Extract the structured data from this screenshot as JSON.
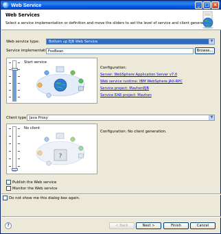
{
  "window": {
    "title": "Web Service"
  },
  "header": {
    "title": "Web Services",
    "description": "Select a service implementation or definition and move the sliders to set the level of service and client generation."
  },
  "service": {
    "type_label": "Web service type:",
    "type_value": "Bottom up EJB Web Service",
    "impl_label": "Service implementation:",
    "impl_value": "FooBean",
    "browse_label": "Browse...",
    "slider_level_label": "Start service",
    "config_title": "Configuration:",
    "config_links": [
      "Server: WebSphere Application Server v7.0",
      "Web service runtime: IBM WebSphere JAX-RPC",
      "Service project: MavhenEJB",
      "Service EAR project: Mavhen"
    ]
  },
  "client": {
    "type_label": "Client type:",
    "type_value": "Java Proxy",
    "slider_level_label": "No client",
    "config_text": "Configuration: No client generation."
  },
  "options": {
    "publish_label": "Publish the Web service",
    "monitor_label": "Monitor the Web service",
    "dont_show_label": "Do not show me this dialog box again."
  },
  "footer": {
    "back_label": "< Back",
    "next_label": "Next >",
    "finish_label": "Finish",
    "cancel_label": "Cancel",
    "help_symbol": "?"
  },
  "levels": {
    "service_fill_fraction": 0.8,
    "client_fill_fraction": 0.0
  },
  "colors": {
    "title_bar": "#0054e3",
    "selection": "#316ac5",
    "link": "#0000ee",
    "dialog_bg": "#ece9d8"
  }
}
